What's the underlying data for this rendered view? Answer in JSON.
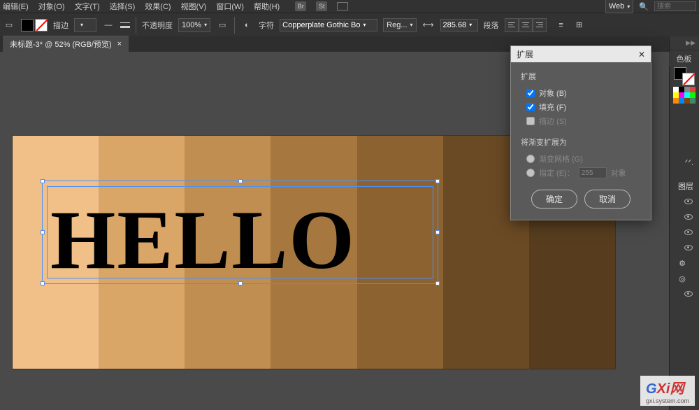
{
  "menu": {
    "items": [
      "编辑(E)",
      "对象(O)",
      "文字(T)",
      "选择(S)",
      "效果(C)",
      "视图(V)",
      "窗口(W)",
      "帮助(H)"
    ],
    "workspace": "Web",
    "search_placeholder": "搜索"
  },
  "toolbar": {
    "stroke_label": "描边",
    "opacity_label": "不透明度",
    "opacity_value": "100%",
    "char_label": "字符",
    "font_name": "Copperplate Gothic Bo",
    "font_style": "Reg...",
    "font_size": "285.68",
    "para_label": "段落"
  },
  "doc": {
    "tab_title": "未标题-3* @ 52% (RGB/预览)"
  },
  "canvas": {
    "text": "HELLO"
  },
  "dialog": {
    "title": "扩展",
    "section1_title": "扩展",
    "cb_object": "对象 (B)",
    "cb_fill": "填充 (F)",
    "cb_stroke": "描边 (S)",
    "section2_title": "将渐变扩展为",
    "radio_mesh": "渐变网格 (G)",
    "radio_spec": "指定 (E)：",
    "spec_value": "255",
    "spec_unit": "对象",
    "ok": "确定",
    "cancel": "取消"
  },
  "panels": {
    "swatches": "色板",
    "layers": "图层"
  },
  "watermark": {
    "brand_g": "G",
    "brand_rest": "Xi网",
    "url": "gxi.system.com"
  }
}
